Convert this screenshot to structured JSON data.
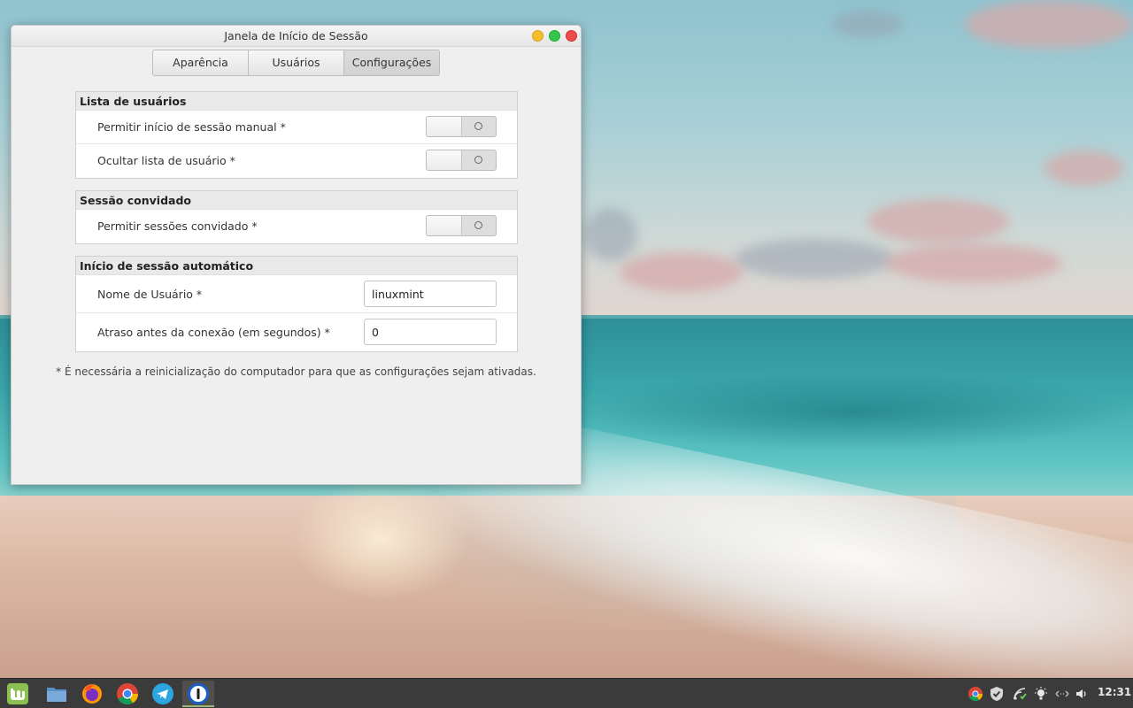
{
  "window": {
    "title": "Janela de Início de Sessão"
  },
  "tabs": [
    {
      "label": "Aparência",
      "active": false
    },
    {
      "label": "Usuários",
      "active": false
    },
    {
      "label": "Configurações",
      "active": true
    }
  ],
  "sections": {
    "user_list": {
      "title": "Lista de usuários",
      "rows": [
        {
          "label": "Permitir início de sessão manual *",
          "switch": "off"
        },
        {
          "label": "Ocultar lista de usuário *",
          "switch": "off"
        }
      ]
    },
    "guest": {
      "title": "Sessão convidado",
      "rows": [
        {
          "label": "Permitir sessões convidado *",
          "switch": "off"
        }
      ]
    },
    "autologin": {
      "title": "Início de sessão automático",
      "username_label": "Nome de Usuário *",
      "username_value": "linuxmint",
      "delay_label": "Atraso antes da conexão (em segundos) *",
      "delay_value": "0"
    }
  },
  "note": "* É necessária a reinicialização do computador para que as configurações sejam ativadas.",
  "taskbar": {
    "apps": [
      {
        "icon": "mint-menu-icon"
      },
      {
        "icon": "files-icon"
      },
      {
        "icon": "firefox-icon"
      },
      {
        "icon": "chrome-icon"
      },
      {
        "icon": "telegram-icon"
      },
      {
        "icon": "1password-icon",
        "active": true
      }
    ],
    "tray": [
      "chrome-icon",
      "shield-check-icon",
      "network-icon",
      "redshift-icon",
      "network-arrows-icon",
      "volume-icon"
    ],
    "clock": "12:31"
  },
  "colors": {
    "close": "#ee4b4b",
    "maximize": "#34c84a",
    "minimize": "#f5bd2c",
    "taskbar": "#3b3b3b"
  }
}
